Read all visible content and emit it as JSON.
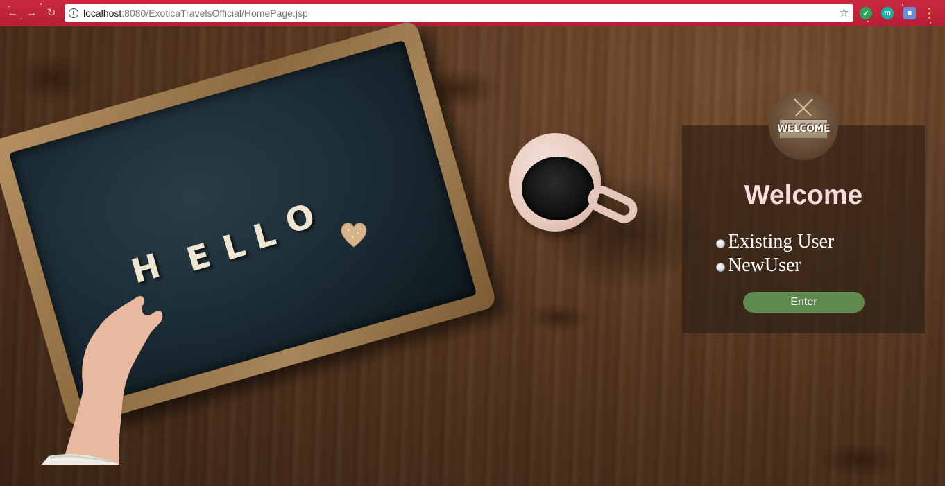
{
  "browser": {
    "url_host": "localhost",
    "url_path": ":8080/ExoticaTravelsOfficial/HomePage.jsp",
    "extensions": [
      {
        "icon": "shield-check-icon",
        "color": "#2ea35a",
        "glyph": "✓"
      },
      {
        "icon": "m-badge-icon",
        "color": "#19b0a6",
        "glyph": "m"
      },
      {
        "icon": "cube-icon",
        "color": "#6b8cd6",
        "glyph": "■"
      }
    ]
  },
  "scene": {
    "chalkboard_letters": [
      "H",
      "E",
      "L",
      "L",
      "O"
    ],
    "sign_text": "WELCOME"
  },
  "panel": {
    "title": "Welcome",
    "options": [
      {
        "label": "Existing User"
      },
      {
        "label": "NewUser"
      }
    ],
    "enter_label": "Enter"
  }
}
